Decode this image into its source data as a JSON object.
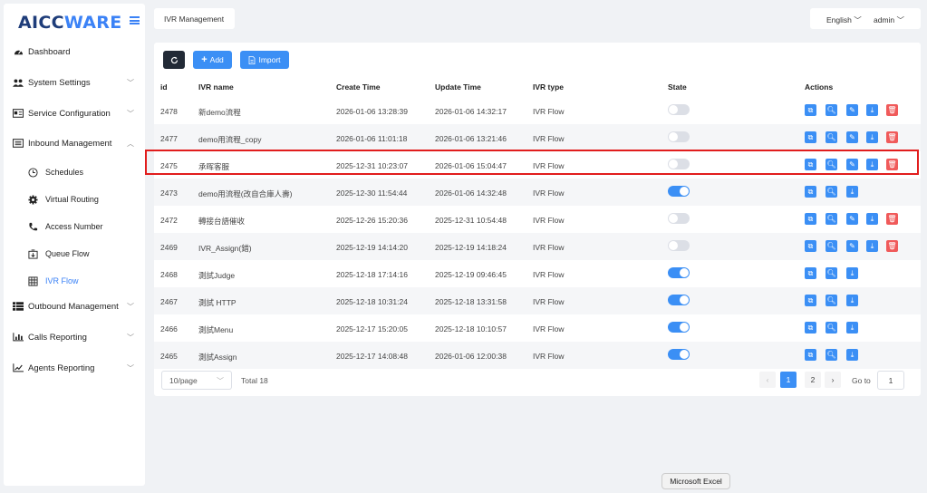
{
  "app": {
    "logo_part1": "AICC",
    "logo_part2": "WARE"
  },
  "sidebar": {
    "items": [
      {
        "label": "Dashboard",
        "icon": "dashboard-icon"
      },
      {
        "label": "System Settings",
        "icon": "users-icon"
      },
      {
        "label": "Service Configuration",
        "icon": "card-icon"
      },
      {
        "label": "Inbound Management",
        "icon": "list-icon"
      },
      {
        "label": "Outbound Management",
        "icon": "list-icon"
      },
      {
        "label": "Calls Reporting",
        "icon": "bar-chart-icon"
      },
      {
        "label": "Agents Reporting",
        "icon": "line-chart-icon"
      }
    ],
    "sub_items": [
      {
        "label": "Schedules",
        "icon": "clock-icon"
      },
      {
        "label": "Virtual Routing",
        "icon": "gear-icon"
      },
      {
        "label": "Access Number",
        "icon": "phone-icon"
      },
      {
        "label": "Queue Flow",
        "icon": "queue-icon"
      },
      {
        "label": "IVR Flow",
        "icon": "grid-icon",
        "active": true
      }
    ]
  },
  "header": {
    "tab": "IVR Management",
    "language": "English",
    "user": "admin"
  },
  "toolbar": {
    "add_label": "Add",
    "import_label": "Import"
  },
  "table": {
    "columns": [
      "id",
      "IVR name",
      "Create Time",
      "Update Time",
      "IVR type",
      "State",
      "Actions"
    ],
    "rows": [
      {
        "id": "2478",
        "name": "新demo流程",
        "create": "2026-01-06 13:28:39",
        "update": "2026-01-06 14:32:17",
        "type": "IVR Flow",
        "state": false,
        "actions": 5
      },
      {
        "id": "2477",
        "name": "demo用流程_copy",
        "create": "2026-01-06 11:01:18",
        "update": "2026-01-06 13:21:46",
        "type": "IVR Flow",
        "state": false,
        "actions": 5
      },
      {
        "id": "2475",
        "name": "承晖客服",
        "create": "2025-12-31 10:23:07",
        "update": "2026-01-06 15:04:47",
        "type": "IVR Flow",
        "state": false,
        "actions": 5
      },
      {
        "id": "2473",
        "name": "demo用流程(改自合庫人壽)",
        "create": "2025-12-30 11:54:44",
        "update": "2026-01-06 14:32:48",
        "type": "IVR Flow",
        "state": true,
        "actions": 3
      },
      {
        "id": "2472",
        "name": "轉接台語催收",
        "create": "2025-12-26 15:20:36",
        "update": "2025-12-31 10:54:48",
        "type": "IVR Flow",
        "state": false,
        "actions": 5
      },
      {
        "id": "2469",
        "name": "IVR_Assign(錯)",
        "create": "2025-12-19 14:14:20",
        "update": "2025-12-19 14:18:24",
        "type": "IVR Flow",
        "state": false,
        "actions": 5
      },
      {
        "id": "2468",
        "name": "測試Judge",
        "create": "2025-12-18 17:14:16",
        "update": "2025-12-19 09:46:45",
        "type": "IVR Flow",
        "state": true,
        "actions": 3
      },
      {
        "id": "2467",
        "name": "測試 HTTP",
        "create": "2025-12-18 10:31:24",
        "update": "2025-12-18 13:31:58",
        "type": "IVR Flow",
        "state": true,
        "actions": 3
      },
      {
        "id": "2466",
        "name": "測試Menu",
        "create": "2025-12-17 15:20:05",
        "update": "2025-12-18 10:10:57",
        "type": "IVR Flow",
        "state": true,
        "actions": 3
      },
      {
        "id": "2465",
        "name": "測試Assign",
        "create": "2025-12-17 14:08:48",
        "update": "2026-01-06 12:00:38",
        "type": "IVR Flow",
        "state": true,
        "actions": 3
      }
    ]
  },
  "pagination": {
    "page_size": "10/page",
    "total": "Total 18",
    "pages": [
      "1",
      "2"
    ],
    "current": "1",
    "goto_label": "Go to",
    "goto_value": "1"
  },
  "tooltip": "Microsoft Excel",
  "colors": {
    "accent": "#3b8ff5",
    "danger": "#f05a5a",
    "highlight": "#e11d1d"
  }
}
